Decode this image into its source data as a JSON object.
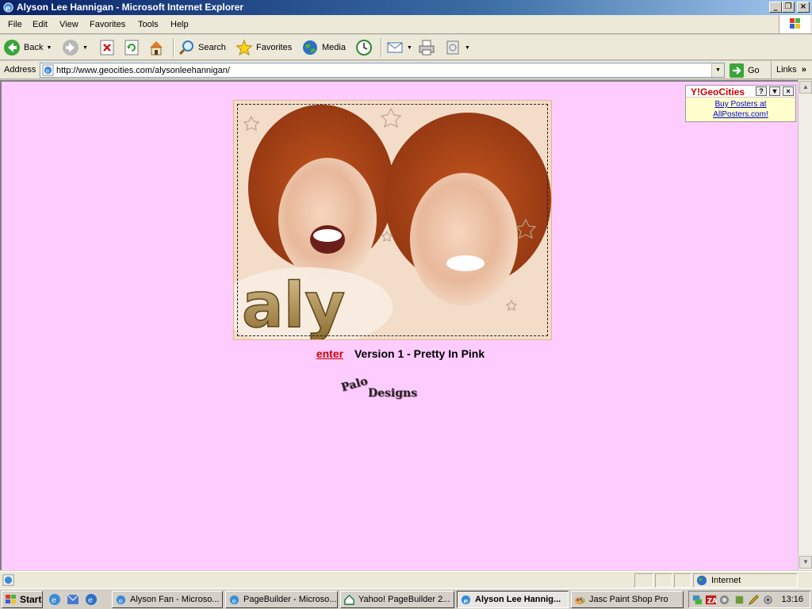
{
  "window": {
    "title": "Alyson Lee Hannigan - Microsoft Internet Explorer"
  },
  "menu": [
    "File",
    "Edit",
    "View",
    "Favorites",
    "Tools",
    "Help"
  ],
  "toolbar": {
    "back": "Back",
    "search": "Search",
    "favorites": "Favorites",
    "media": "Media"
  },
  "address": {
    "label": "Address",
    "url": "http://www.geocities.com/alysonleehannigan/",
    "go": "Go",
    "links": "Links"
  },
  "page": {
    "background": "#ffccff",
    "banner_text": "aly",
    "enter_link": "enter",
    "version_text": "Version 1 - Pretty In Pink",
    "logo_word1": "Palo",
    "logo_word2": "Designs"
  },
  "geocities_ad": {
    "brand_prefix": "Y!",
    "brand": "GeoCities",
    "line1": "Buy Posters at",
    "line2": "AllPosters.com!"
  },
  "status": {
    "zone": "Internet"
  },
  "taskbar": {
    "start": "Start",
    "tasks": [
      "Alyson Fan - Microso...",
      "PageBuilder - Microso...",
      "Yahoo! PageBuilder 2...",
      "Alyson Lee Hannig...",
      "Jasc Paint Shop Pro"
    ],
    "clock": "13:16"
  }
}
